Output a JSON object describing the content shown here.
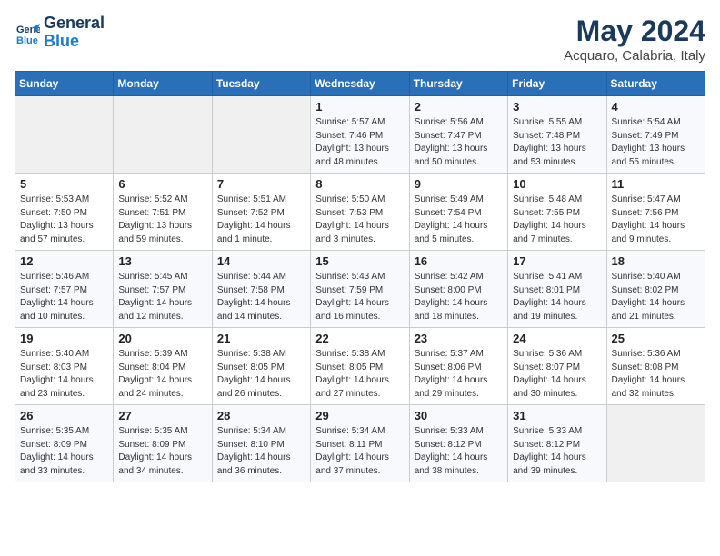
{
  "logo": {
    "line1": "General",
    "line2": "Blue"
  },
  "title": "May 2024",
  "subtitle": "Acquaro, Calabria, Italy",
  "weekdays": [
    "Sunday",
    "Monday",
    "Tuesday",
    "Wednesday",
    "Thursday",
    "Friday",
    "Saturday"
  ],
  "weeks": [
    [
      {
        "day": "",
        "sunrise": "",
        "sunset": "",
        "daylight": ""
      },
      {
        "day": "",
        "sunrise": "",
        "sunset": "",
        "daylight": ""
      },
      {
        "day": "",
        "sunrise": "",
        "sunset": "",
        "daylight": ""
      },
      {
        "day": "1",
        "sunrise": "Sunrise: 5:57 AM",
        "sunset": "Sunset: 7:46 PM",
        "daylight": "Daylight: 13 hours and 48 minutes."
      },
      {
        "day": "2",
        "sunrise": "Sunrise: 5:56 AM",
        "sunset": "Sunset: 7:47 PM",
        "daylight": "Daylight: 13 hours and 50 minutes."
      },
      {
        "day": "3",
        "sunrise": "Sunrise: 5:55 AM",
        "sunset": "Sunset: 7:48 PM",
        "daylight": "Daylight: 13 hours and 53 minutes."
      },
      {
        "day": "4",
        "sunrise": "Sunrise: 5:54 AM",
        "sunset": "Sunset: 7:49 PM",
        "daylight": "Daylight: 13 hours and 55 minutes."
      }
    ],
    [
      {
        "day": "5",
        "sunrise": "Sunrise: 5:53 AM",
        "sunset": "Sunset: 7:50 PM",
        "daylight": "Daylight: 13 hours and 57 minutes."
      },
      {
        "day": "6",
        "sunrise": "Sunrise: 5:52 AM",
        "sunset": "Sunset: 7:51 PM",
        "daylight": "Daylight: 13 hours and 59 minutes."
      },
      {
        "day": "7",
        "sunrise": "Sunrise: 5:51 AM",
        "sunset": "Sunset: 7:52 PM",
        "daylight": "Daylight: 14 hours and 1 minute."
      },
      {
        "day": "8",
        "sunrise": "Sunrise: 5:50 AM",
        "sunset": "Sunset: 7:53 PM",
        "daylight": "Daylight: 14 hours and 3 minutes."
      },
      {
        "day": "9",
        "sunrise": "Sunrise: 5:49 AM",
        "sunset": "Sunset: 7:54 PM",
        "daylight": "Daylight: 14 hours and 5 minutes."
      },
      {
        "day": "10",
        "sunrise": "Sunrise: 5:48 AM",
        "sunset": "Sunset: 7:55 PM",
        "daylight": "Daylight: 14 hours and 7 minutes."
      },
      {
        "day": "11",
        "sunrise": "Sunrise: 5:47 AM",
        "sunset": "Sunset: 7:56 PM",
        "daylight": "Daylight: 14 hours and 9 minutes."
      }
    ],
    [
      {
        "day": "12",
        "sunrise": "Sunrise: 5:46 AM",
        "sunset": "Sunset: 7:57 PM",
        "daylight": "Daylight: 14 hours and 10 minutes."
      },
      {
        "day": "13",
        "sunrise": "Sunrise: 5:45 AM",
        "sunset": "Sunset: 7:57 PM",
        "daylight": "Daylight: 14 hours and 12 minutes."
      },
      {
        "day": "14",
        "sunrise": "Sunrise: 5:44 AM",
        "sunset": "Sunset: 7:58 PM",
        "daylight": "Daylight: 14 hours and 14 minutes."
      },
      {
        "day": "15",
        "sunrise": "Sunrise: 5:43 AM",
        "sunset": "Sunset: 7:59 PM",
        "daylight": "Daylight: 14 hours and 16 minutes."
      },
      {
        "day": "16",
        "sunrise": "Sunrise: 5:42 AM",
        "sunset": "Sunset: 8:00 PM",
        "daylight": "Daylight: 14 hours and 18 minutes."
      },
      {
        "day": "17",
        "sunrise": "Sunrise: 5:41 AM",
        "sunset": "Sunset: 8:01 PM",
        "daylight": "Daylight: 14 hours and 19 minutes."
      },
      {
        "day": "18",
        "sunrise": "Sunrise: 5:40 AM",
        "sunset": "Sunset: 8:02 PM",
        "daylight": "Daylight: 14 hours and 21 minutes."
      }
    ],
    [
      {
        "day": "19",
        "sunrise": "Sunrise: 5:40 AM",
        "sunset": "Sunset: 8:03 PM",
        "daylight": "Daylight: 14 hours and 23 minutes."
      },
      {
        "day": "20",
        "sunrise": "Sunrise: 5:39 AM",
        "sunset": "Sunset: 8:04 PM",
        "daylight": "Daylight: 14 hours and 24 minutes."
      },
      {
        "day": "21",
        "sunrise": "Sunrise: 5:38 AM",
        "sunset": "Sunset: 8:05 PM",
        "daylight": "Daylight: 14 hours and 26 minutes."
      },
      {
        "day": "22",
        "sunrise": "Sunrise: 5:38 AM",
        "sunset": "Sunset: 8:05 PM",
        "daylight": "Daylight: 14 hours and 27 minutes."
      },
      {
        "day": "23",
        "sunrise": "Sunrise: 5:37 AM",
        "sunset": "Sunset: 8:06 PM",
        "daylight": "Daylight: 14 hours and 29 minutes."
      },
      {
        "day": "24",
        "sunrise": "Sunrise: 5:36 AM",
        "sunset": "Sunset: 8:07 PM",
        "daylight": "Daylight: 14 hours and 30 minutes."
      },
      {
        "day": "25",
        "sunrise": "Sunrise: 5:36 AM",
        "sunset": "Sunset: 8:08 PM",
        "daylight": "Daylight: 14 hours and 32 minutes."
      }
    ],
    [
      {
        "day": "26",
        "sunrise": "Sunrise: 5:35 AM",
        "sunset": "Sunset: 8:09 PM",
        "daylight": "Daylight: 14 hours and 33 minutes."
      },
      {
        "day": "27",
        "sunrise": "Sunrise: 5:35 AM",
        "sunset": "Sunset: 8:09 PM",
        "daylight": "Daylight: 14 hours and 34 minutes."
      },
      {
        "day": "28",
        "sunrise": "Sunrise: 5:34 AM",
        "sunset": "Sunset: 8:10 PM",
        "daylight": "Daylight: 14 hours and 36 minutes."
      },
      {
        "day": "29",
        "sunrise": "Sunrise: 5:34 AM",
        "sunset": "Sunset: 8:11 PM",
        "daylight": "Daylight: 14 hours and 37 minutes."
      },
      {
        "day": "30",
        "sunrise": "Sunrise: 5:33 AM",
        "sunset": "Sunset: 8:12 PM",
        "daylight": "Daylight: 14 hours and 38 minutes."
      },
      {
        "day": "31",
        "sunrise": "Sunrise: 5:33 AM",
        "sunset": "Sunset: 8:12 PM",
        "daylight": "Daylight: 14 hours and 39 minutes."
      },
      {
        "day": "",
        "sunrise": "",
        "sunset": "",
        "daylight": ""
      }
    ]
  ]
}
